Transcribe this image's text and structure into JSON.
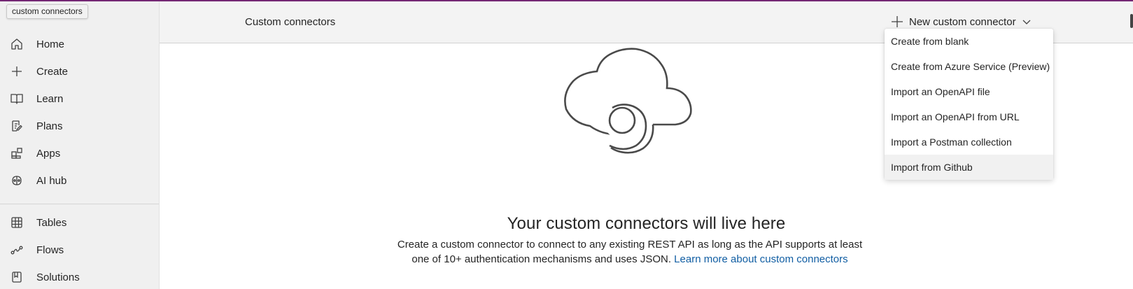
{
  "tooltip": "custom connectors",
  "sidebar": {
    "items": [
      {
        "label": "Home",
        "icon": "home-icon"
      },
      {
        "label": "Create",
        "icon": "plus-icon"
      },
      {
        "label": "Learn",
        "icon": "book-icon"
      },
      {
        "label": "Plans",
        "icon": "plans-icon"
      },
      {
        "label": "Apps",
        "icon": "apps-icon"
      },
      {
        "label": "AI hub",
        "icon": "ai-hub-icon"
      },
      {
        "label": "Tables",
        "icon": "table-icon"
      },
      {
        "label": "Flows",
        "icon": "flows-icon"
      },
      {
        "label": "Solutions",
        "icon": "solutions-icon"
      }
    ]
  },
  "header": {
    "title": "Custom connectors",
    "new_button_label": "New custom connector"
  },
  "menu": {
    "items": [
      "Create from blank",
      "Create from Azure Service (Preview)",
      "Import an OpenAPI file",
      "Import an OpenAPI from URL",
      "Import a Postman collection",
      "Import from Github"
    ],
    "hovered_index": 5
  },
  "empty_state": {
    "title": "Your custom connectors will live here",
    "description": "Create a custom connector to connect to any existing REST API as long as the API supports at least one of 10+ authentication mechanisms and uses JSON.",
    "link_text": "Learn more about custom connectors"
  },
  "colors": {
    "accent": "#742774",
    "link": "#115ea3"
  }
}
